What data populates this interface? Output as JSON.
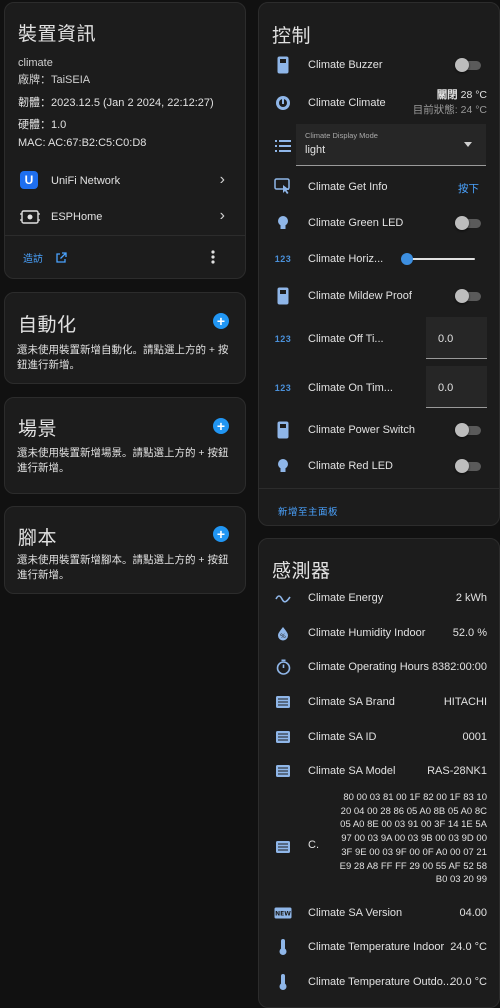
{
  "device_info": {
    "title": "裝置資訊",
    "model": "climate",
    "manufacturer": "廠牌：TaiSEIA",
    "firmware": "韌體：2023.12.5 (Jan 2 2024, 22:12:27)",
    "hardware": "硬體：1.0",
    "mac": "MAC: AC:67:B2:C5:C0:D8",
    "links": [
      {
        "label": "UniFi Network"
      },
      {
        "label": "ESPHome"
      }
    ],
    "visit_label": "造訪"
  },
  "automation": {
    "title": "自動化",
    "empty_text": "還未使用裝置新增自動化。請點選上方的 + 按鈕進行新增。"
  },
  "scene": {
    "title": "場景",
    "empty_text": "還未使用裝置新增場景。請點選上方的 + 按鈕進行新增。"
  },
  "script": {
    "title": "腳本",
    "empty_text": "還未使用裝置新增腳本。請點選上方的 + 按鈕進行新增。"
  },
  "control": {
    "title": "控制",
    "buzzer": {
      "label": "Climate Buzzer",
      "on": false
    },
    "climate": {
      "label": "Climate Climate",
      "state_prefix": "關閉",
      "target": "28 °C",
      "current": "目前狀態: 24 °C"
    },
    "display_mode": {
      "field_label": "Climate Display Mode",
      "value": "light"
    },
    "get_info": {
      "label": "Climate Get Info",
      "action": "按下"
    },
    "green_led": {
      "label": "Climate Green LED",
      "on": false
    },
    "horiz": {
      "label": "Climate Horiz...",
      "value_fraction": 0.0
    },
    "mildew": {
      "label": "Climate Mildew Proof",
      "on": false
    },
    "off_timer": {
      "label": "Climate Off Ti...",
      "value": "0.0"
    },
    "on_timer": {
      "label": "Climate On Tim...",
      "value": "0.0"
    },
    "power": {
      "label": "Climate Power Switch",
      "on": false
    },
    "red_led": {
      "label": "Climate Red LED",
      "on": false
    },
    "add_to_dashboard": "新增至主面板"
  },
  "sensors": {
    "title": "感測器",
    "energy": {
      "label": "Climate Energy",
      "value": "2 kWh"
    },
    "humidity": {
      "label": "Climate Humidity Indoor",
      "value": "52.0 %"
    },
    "hours": {
      "label": "Climate Operating Hours",
      "value": "8382:00:00"
    },
    "brand": {
      "label": "Climate SA Brand",
      "value": "HITACHI"
    },
    "sa_id": {
      "label": "Climate SA ID",
      "value": "0001"
    },
    "sa_model": {
      "label": "Climate SA Model",
      "value": "RAS-28NK1"
    },
    "raw": {
      "label": "C.",
      "lines": [
        "80 00 03 81 00 1F 82 00 1F 83 10",
        "20 04 00 28 86 05 A0 8B 05 A0 8C",
        "05 A0 8E 00 03 91 00 3F 14 1E 5A",
        "97 00 03 9A 00 03 9B 00 03 9D 00",
        "3F 9E 00 03 9F 00 0F A0 00 07 21",
        "E9 28 A8 FF FF 29 00 55 AF 52 58",
        "B0 03 20 99"
      ]
    },
    "sa_version": {
      "label": "Climate SA Version",
      "value": "04.00"
    },
    "temp_in": {
      "label": "Climate Temperature Indoor",
      "value": "24.0 °C"
    },
    "temp_out": {
      "label": "Climate Temperature Outdo...",
      "value": "20.0 °C"
    }
  }
}
